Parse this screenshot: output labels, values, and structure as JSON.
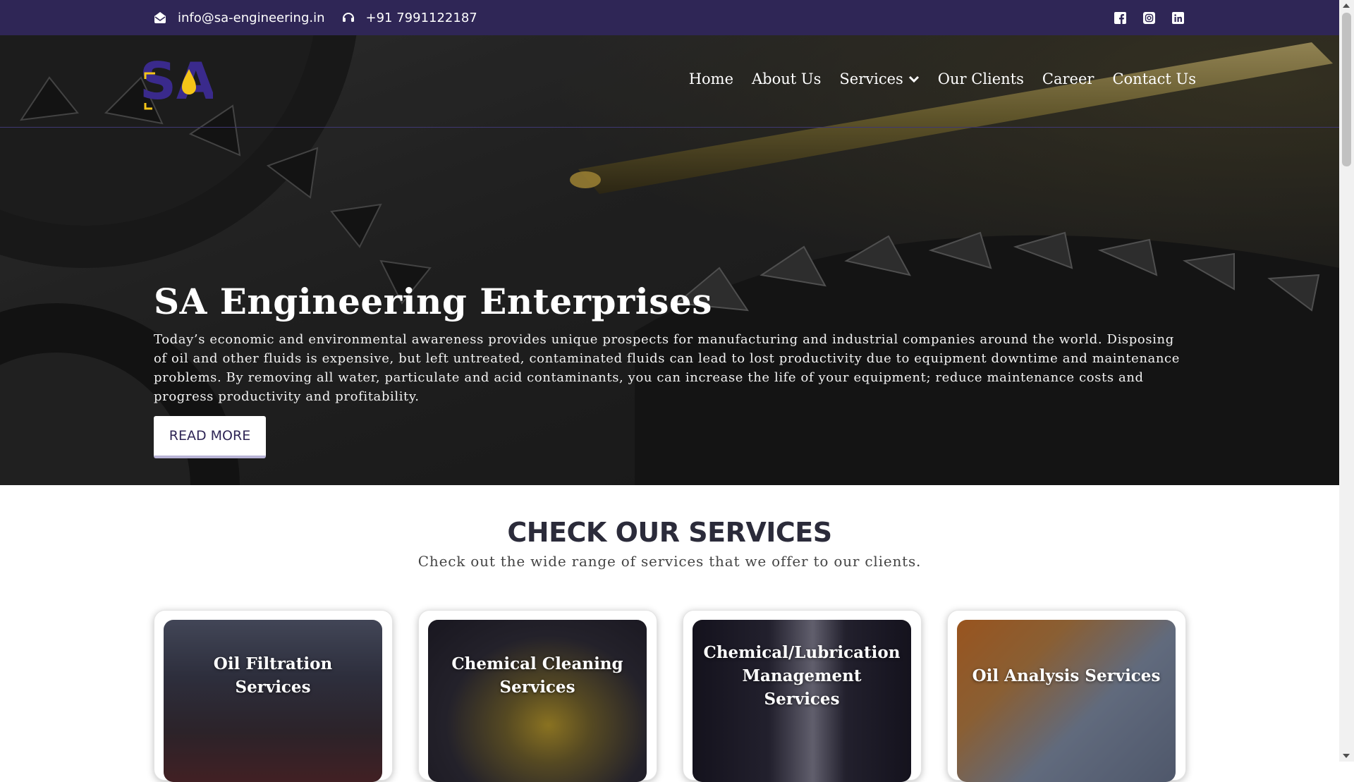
{
  "topbar": {
    "email": "info@sa-engineering.in",
    "phone": "+91 7991122187",
    "email_icon": "envelope-open-icon",
    "phone_icon": "headset-icon",
    "social_icons": [
      "facebook-icon",
      "instagram-icon",
      "linkedin-icon"
    ]
  },
  "brand": {
    "logo_text": "SA",
    "logo_icon": "oil-drop-icon",
    "accent": "#f5c518",
    "primary": "#2f2656"
  },
  "nav": {
    "items": [
      "Home",
      "About Us",
      "Services",
      "Our Clients",
      "Career",
      "Contact Us"
    ],
    "dropdown_icon": "chevron-down-icon"
  },
  "hero": {
    "title": "SA Engineering Enterprises",
    "text": "Today’s economic and environmental awareness provides unique prospects for manufacturing and industrial companies around the world. Disposing of oil and other fluids is expensive, but left untreated, contaminated fluids can lead to lost productivity due to equipment downtime and maintenance problems. By removing all water, particulate and acid contaminants, you can increase the life of your equipment; reduce maintenance costs and progress productivity and profitability.",
    "button": "READ MORE"
  },
  "services": {
    "title": "CHECK OUR SERVICES",
    "subtitle": "Check out the wide range of services that we offer to our clients.",
    "cards": [
      {
        "label": "Oil Filtration Services"
      },
      {
        "label": "Chemical Cleaning Services"
      },
      {
        "label": "Chemical/Lubrication Management Services"
      },
      {
        "label": "Oil Analysis Services"
      }
    ]
  }
}
